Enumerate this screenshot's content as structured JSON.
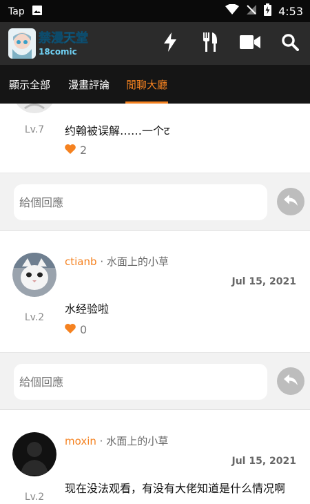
{
  "status_bar": {
    "app_label": "Tap",
    "time": "4:53",
    "icons": [
      "image-icon",
      "wifi-icon",
      "no-signal-icon",
      "battery-charging-icon"
    ]
  },
  "app_bar": {
    "logo_text": "禁漫天堂",
    "logo_subtext": "18comic",
    "actions": [
      "flash-icon",
      "utensils-icon",
      "video-icon",
      "search-icon"
    ]
  },
  "tabs": [
    {
      "label": "顯示全部"
    },
    {
      "label": "漫畫評論"
    },
    {
      "label": "閒聊大廳",
      "active": true
    }
  ],
  "comments": [
    {
      "level": "Lv.7",
      "text": "约翰被误解……一个ट",
      "likes": "2"
    },
    {
      "username": "ctianb",
      "separator": "·",
      "group": "水面上的小草",
      "date": "Jul 15, 2021",
      "level": "Lv.2",
      "text": "水经验啦",
      "likes": "0"
    },
    {
      "username": "moxin",
      "separator": "·",
      "group": "水面上的小草",
      "date": "Jul 15, 2021",
      "level": "Lv.2",
      "text": "现在没法观看，有没有大佬知道是什么情况啊"
    }
  ],
  "reply": {
    "placeholder": "給個回應"
  },
  "colors": {
    "accent": "#f58220",
    "app_bar": "#2b2b2b",
    "tab_bar": "#151515"
  }
}
